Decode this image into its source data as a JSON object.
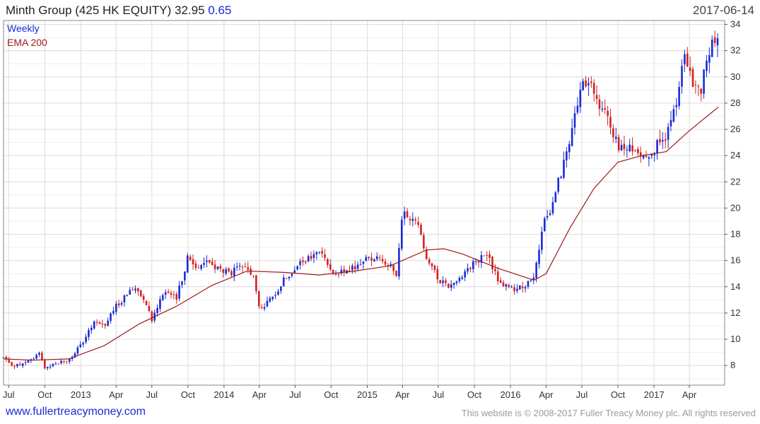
{
  "header": {
    "title_main": "Minth Group (425 HK EQUITY) 32.95",
    "title_change": "0.65",
    "date": "2017-06-14"
  },
  "footer": {
    "site": "www.fullertreacymoney.com",
    "copyright": "This website is © 2008-2017 Fuller Treacy Money plc. All rights reserved"
  },
  "colors": {
    "up": "#1a2ad8",
    "down": "#d42020",
    "ema": "#a01818",
    "grid": "#dcdcdc"
  },
  "chart_data": {
    "type": "line",
    "title": "Minth Group (425 HK EQUITY) 32.95 0.65",
    "frequency_label": "Weekly",
    "legend": [
      {
        "name": "Weekly",
        "color": "#1a2ad8"
      },
      {
        "name": "EMA 200",
        "color": "#a01818"
      }
    ],
    "legend_position": "top-left",
    "grid": true,
    "y_axis_side": "right",
    "ylim": [
      6.5,
      34.3
    ],
    "yticks": [
      8,
      10,
      12,
      14,
      16,
      18,
      20,
      22,
      24,
      26,
      28,
      30,
      32,
      34
    ],
    "xlim": [
      "2012-06-18",
      "2017-06-30"
    ],
    "xticks": [
      {
        "label": "Jul",
        "date": "2012-07-01"
      },
      {
        "label": "Oct",
        "date": "2012-10-01"
      },
      {
        "label": "2013",
        "date": "2013-01-01"
      },
      {
        "label": "Apr",
        "date": "2013-04-01"
      },
      {
        "label": "Jul",
        "date": "2013-07-01"
      },
      {
        "label": "Oct",
        "date": "2013-10-01"
      },
      {
        "label": "2014",
        "date": "2014-01-01"
      },
      {
        "label": "Apr",
        "date": "2014-04-01"
      },
      {
        "label": "Jul",
        "date": "2014-07-01"
      },
      {
        "label": "Oct",
        "date": "2014-10-01"
      },
      {
        "label": "2015",
        "date": "2015-01-01"
      },
      {
        "label": "Apr",
        "date": "2015-04-01"
      },
      {
        "label": "Jul",
        "date": "2015-07-01"
      },
      {
        "label": "Oct",
        "date": "2015-10-01"
      },
      {
        "label": "2016",
        "date": "2016-01-01"
      },
      {
        "label": "Apr",
        "date": "2016-04-01"
      },
      {
        "label": "Jul",
        "date": "2016-07-01"
      },
      {
        "label": "Oct",
        "date": "2016-10-01"
      },
      {
        "label": "2017",
        "date": "2017-01-01"
      },
      {
        "label": "Apr",
        "date": "2017-04-01"
      }
    ],
    "series": [
      {
        "name": "Weekly",
        "kind": "close",
        "x": [
          "2012-06-18",
          "2012-07-01",
          "2012-08-01",
          "2012-09-01",
          "2012-09-15",
          "2012-10-01",
          "2012-10-15",
          "2012-11-01",
          "2012-12-01",
          "2013-01-01",
          "2013-01-20",
          "2013-02-10",
          "2013-03-01",
          "2013-04-01",
          "2013-05-01",
          "2013-05-20",
          "2013-06-15",
          "2013-07-01",
          "2013-08-01",
          "2013-09-01",
          "2013-10-01",
          "2013-10-20",
          "2013-11-15",
          "2013-12-15",
          "2014-01-15",
          "2014-02-15",
          "2014-03-15",
          "2014-04-01",
          "2014-05-01",
          "2014-06-01",
          "2014-07-01",
          "2014-08-01",
          "2014-09-01",
          "2014-10-01",
          "2014-11-01",
          "2014-12-01",
          "2015-01-01",
          "2015-02-01",
          "2015-03-01",
          "2015-03-15",
          "2015-04-01",
          "2015-04-20",
          "2015-05-15",
          "2015-06-01",
          "2015-07-01",
          "2015-07-15",
          "2015-08-01",
          "2015-09-01",
          "2015-10-01",
          "2015-11-01",
          "2015-12-01",
          "2016-01-01",
          "2016-02-01",
          "2016-03-01",
          "2016-03-20",
          "2016-04-01",
          "2016-04-15",
          "2016-05-01",
          "2016-06-01",
          "2016-07-01",
          "2016-08-01",
          "2016-08-20",
          "2016-09-01",
          "2016-10-01",
          "2016-11-01",
          "2016-12-01",
          "2017-01-01",
          "2017-02-01",
          "2017-03-01",
          "2017-03-20",
          "2017-04-01",
          "2017-05-01",
          "2017-05-20",
          "2017-06-14"
        ],
        "y": [
          8.6,
          8.1,
          8.0,
          8.5,
          9.0,
          7.9,
          8.0,
          8.2,
          8.4,
          9.5,
          10.5,
          11.5,
          11.0,
          12.5,
          13.5,
          14.0,
          13.0,
          11.5,
          13.8,
          13.0,
          16.3,
          15.5,
          16.0,
          15.4,
          15.0,
          15.5,
          15.0,
          12.3,
          13.0,
          14.5,
          15.5,
          16.0,
          16.7,
          15.3,
          15.0,
          15.5,
          16.2,
          16.2,
          15.6,
          14.5,
          19.5,
          19.3,
          18.5,
          16.3,
          14.5,
          14.5,
          14.0,
          15.0,
          15.8,
          16.5,
          14.5,
          13.8,
          14.0,
          14.5,
          18.0,
          19.5,
          20.0,
          22.0,
          25.0,
          29.5,
          29.0,
          27.0,
          27.5,
          24.5,
          24.5,
          24.0,
          24.5,
          25.5,
          28.0,
          32.0,
          30.0,
          29.0,
          32.0,
          32.95
        ]
      },
      {
        "name": "EMA 200",
        "kind": "line",
        "x": [
          "2012-06-18",
          "2012-09-01",
          "2012-12-01",
          "2013-03-01",
          "2013-06-01",
          "2013-09-01",
          "2013-12-01",
          "2014-03-01",
          "2014-06-01",
          "2014-09-01",
          "2014-12-01",
          "2015-03-01",
          "2015-06-01",
          "2015-07-15",
          "2015-09-01",
          "2015-12-01",
          "2016-03-01",
          "2016-04-01",
          "2016-06-01",
          "2016-08-01",
          "2016-10-01",
          "2016-12-01",
          "2017-02-01",
          "2017-04-01",
          "2017-06-14"
        ],
        "y": [
          8.5,
          8.4,
          8.5,
          9.5,
          11.2,
          12.5,
          14.1,
          15.2,
          15.1,
          14.9,
          15.2,
          15.6,
          16.8,
          16.9,
          16.5,
          15.4,
          14.5,
          15.0,
          18.5,
          21.5,
          23.5,
          24.0,
          24.3,
          25.9,
          27.7
        ]
      }
    ]
  }
}
